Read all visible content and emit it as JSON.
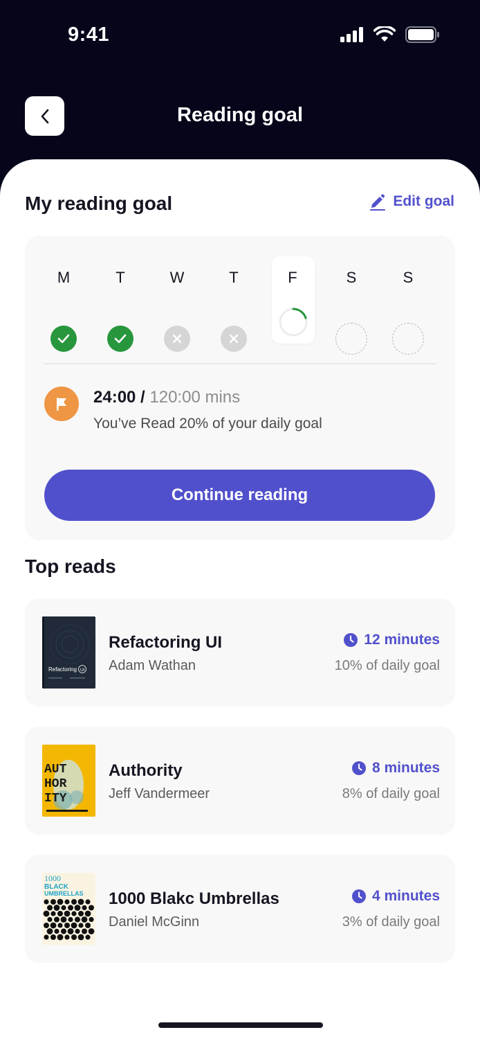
{
  "status_bar": {
    "time": "9:41"
  },
  "header": {
    "title": "Reading goal"
  },
  "goal": {
    "section_title": "My reading goal",
    "edit_label": "Edit goal",
    "days": [
      {
        "label": "M",
        "status": "done"
      },
      {
        "label": "T",
        "status": "done"
      },
      {
        "label": "W",
        "status": "missed"
      },
      {
        "label": "T",
        "status": "missed"
      },
      {
        "label": "F",
        "status": "in-progress"
      },
      {
        "label": "S",
        "status": "upcoming"
      },
      {
        "label": "S",
        "status": "upcoming"
      }
    ],
    "progress_read": "24:00 /",
    "progress_total": "120:00 mins",
    "progress_desc": "You’ve Read 20% of your daily goal",
    "today_progress": 0.2,
    "continue_label": "Continue reading"
  },
  "top_reads": {
    "section_title": "Top reads",
    "items": [
      {
        "title": "Refactoring UI",
        "author": "Adam Wathan",
        "time": "12 minutes",
        "percent": "10% of daily goal",
        "cover_text": "RefactoringUI"
      },
      {
        "title": "Authority",
        "author": "Jeff Vandermeer",
        "time": "8 minutes",
        "percent": "8% of daily goal",
        "cover_text": "AUTHORITY"
      },
      {
        "title": "1000 Blakc Umbrellas",
        "author": "Daniel McGinn",
        "time": "4 minutes",
        "percent": "3% of daily goal",
        "cover_text": "1000 BLACK UMBRELLAS"
      }
    ]
  },
  "colors": {
    "accent": "#5150cc",
    "success": "#27963c",
    "flag": "#ef9645",
    "header_bg": "#05061a"
  }
}
